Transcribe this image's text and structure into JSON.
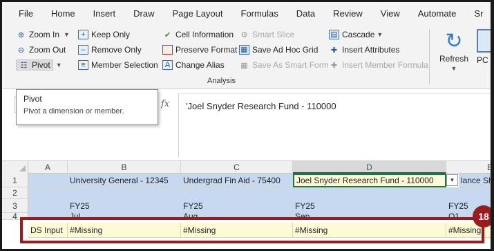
{
  "menu": [
    "File",
    "Home",
    "Insert",
    "Draw",
    "Page Layout",
    "Formulas",
    "Data",
    "Review",
    "View",
    "Automate",
    "Sr"
  ],
  "ribbon": {
    "zoom_in": "Zoom In",
    "zoom_out": "Zoom Out",
    "pivot": "Pivot",
    "keep_only": "Keep Only",
    "remove_only": "Remove Only",
    "member_selection": "Member Selection",
    "cell_information": "Cell Information",
    "preserve_format": "Preserve Format",
    "change_alias": "Change Alias",
    "smart_slice": "Smart Slice",
    "save_ad_hoc_grid": "Save Ad Hoc Grid",
    "save_as_smart_form": "Save As Smart Form",
    "cascade": "Cascade",
    "insert_attributes": "Insert Attributes",
    "insert_member_formula": "Insert Member Formula",
    "group_label": "Analysis",
    "refresh": "Refresh",
    "pc": "PC"
  },
  "tooltip": {
    "title": "Pivot",
    "description": "Pivot a dimension or member."
  },
  "formula_bar": {
    "fx": "fx",
    "value": "'Joel Snyder Research Fund - 110000"
  },
  "grid": {
    "columns": [
      "A",
      "B",
      "C",
      "D",
      "E"
    ],
    "rows": [
      "1",
      "2",
      "3",
      "4"
    ],
    "row1": [
      "",
      "University General - 12345",
      "Undergrad Fin Aid - 75400",
      "Joel Snyder Research Fund - 110000",
      "lance Sh"
    ],
    "row3": [
      "",
      "FY25",
      "FY25",
      "FY25",
      "FY25"
    ],
    "row4_partial": [
      "",
      "Jul",
      "Aug",
      "Sep",
      "Q1"
    ],
    "row5": [
      "DS Input",
      "#Missing",
      "#Missing",
      "#Missing",
      "#Missing"
    ]
  },
  "callout_number": "18",
  "colors": {
    "accent_green": "#217346",
    "cell_blue": "#c6d9f1",
    "cell_yellow": "#fff9d6",
    "callout_red": "#9b1c1c"
  }
}
